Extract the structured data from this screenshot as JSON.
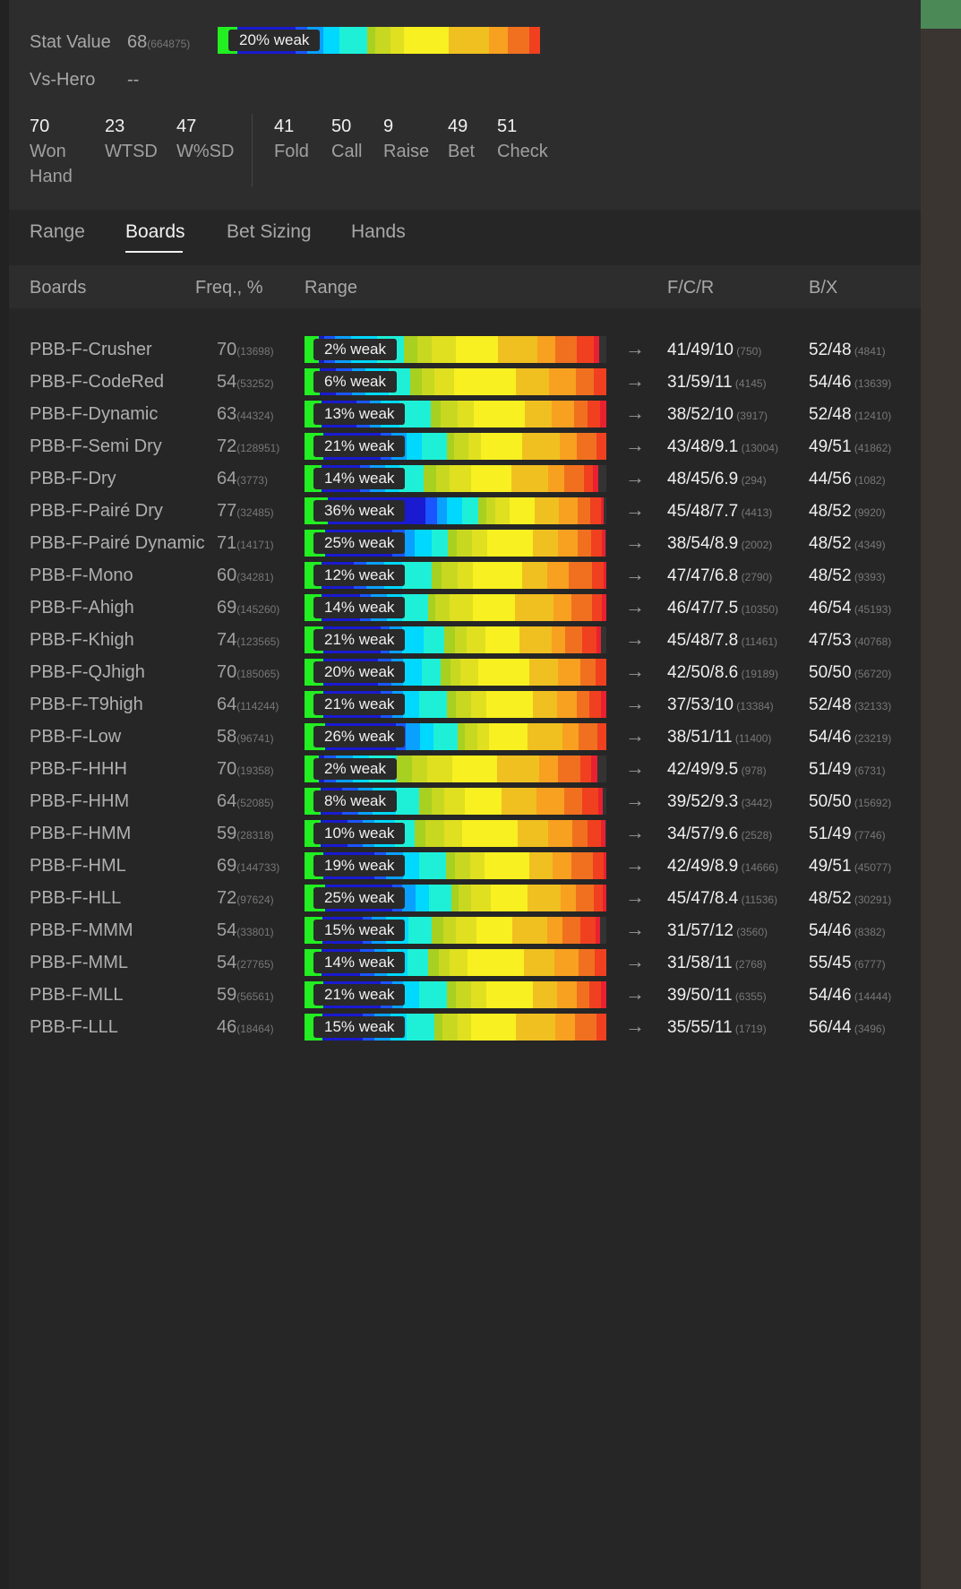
{
  "stat_value": {
    "label": "Stat Value",
    "value": "68",
    "count": "(664875)",
    "weak_label": "20% weak",
    "weak_pct": 20
  },
  "vs_hero": {
    "label": "Vs-Hero",
    "value": "--"
  },
  "counters_left": [
    {
      "value": "70",
      "label": "Won Hand"
    },
    {
      "value": "23",
      "label": "WTSD"
    },
    {
      "value": "47",
      "label": "W%SD"
    }
  ],
  "counters_right": [
    {
      "value": "41",
      "label": "Fold"
    },
    {
      "value": "50",
      "label": "Call"
    },
    {
      "value": "9",
      "label": "Raise"
    },
    {
      "value": "49",
      "label": "Bet"
    },
    {
      "value": "51",
      "label": "Check"
    }
  ],
  "tabs": [
    {
      "label": "Range",
      "active": false
    },
    {
      "label": "Boards",
      "active": true
    },
    {
      "label": "Bet Sizing",
      "active": false
    },
    {
      "label": "Hands",
      "active": false
    }
  ],
  "table_header": {
    "boards": "Boards",
    "freq": "Freq., %",
    "range": "Range",
    "fcr": "F/C/R",
    "bx": "B/X"
  },
  "arrow": "→",
  "colors": {
    "accent_green": "#22ee22",
    "weak_blue": "#1a1ad0",
    "bg": "#262626"
  },
  "rows": [
    {
      "name": "PBB-F-Crusher",
      "freq": "70",
      "freq_count": "(13698)",
      "weak": "2% weak",
      "weak_pct": 2,
      "fcr": "41/49/10",
      "fcr_count": "(750)",
      "bx": "52/48",
      "bx_count": "(4841)"
    },
    {
      "name": "PBB-F-CodeRed",
      "freq": "54",
      "freq_count": "(53252)",
      "weak": "6% weak",
      "weak_pct": 6,
      "fcr": "31/59/11",
      "fcr_count": "(4145)",
      "bx": "54/46",
      "bx_count": "(13639)"
    },
    {
      "name": "PBB-F-Dynamic",
      "freq": "63",
      "freq_count": "(44324)",
      "weak": "13% weak",
      "weak_pct": 13,
      "fcr": "38/52/10",
      "fcr_count": "(3917)",
      "bx": "52/48",
      "bx_count": "(12410)"
    },
    {
      "name": "PBB-F-Semi Dry",
      "freq": "72",
      "freq_count": "(128951)",
      "weak": "21% weak",
      "weak_pct": 21,
      "fcr": "43/48/9.1",
      "fcr_count": "(13004)",
      "bx": "49/51",
      "bx_count": "(41862)"
    },
    {
      "name": "PBB-F-Dry",
      "freq": "64",
      "freq_count": "(3773)",
      "weak": "14% weak",
      "weak_pct": 14,
      "fcr": "48/45/6.9",
      "fcr_count": "(294)",
      "bx": "44/56",
      "bx_count": "(1082)"
    },
    {
      "name": "PBB-F-Pairé Dry",
      "freq": "77",
      "freq_count": "(32485)",
      "weak": "36% weak",
      "weak_pct": 36,
      "fcr": "45/48/7.7",
      "fcr_count": "(4413)",
      "bx": "48/52",
      "bx_count": "(9920)"
    },
    {
      "name": "PBB-F-Pairé Dynamic",
      "freq": "71",
      "freq_count": "(14171)",
      "weak": "25% weak",
      "weak_pct": 25,
      "fcr": "38/54/8.9",
      "fcr_count": "(2002)",
      "bx": "48/52",
      "bx_count": "(4349)"
    },
    {
      "name": "PBB-F-Mono",
      "freq": "60",
      "freq_count": "(34281)",
      "weak": "12% weak",
      "weak_pct": 12,
      "fcr": "47/47/6.8",
      "fcr_count": "(2790)",
      "bx": "48/52",
      "bx_count": "(9393)"
    },
    {
      "name": "PBB-F-Ahigh",
      "freq": "69",
      "freq_count": "(145260)",
      "weak": "14% weak",
      "weak_pct": 14,
      "fcr": "46/47/7.5",
      "fcr_count": "(10350)",
      "bx": "46/54",
      "bx_count": "(45193)"
    },
    {
      "name": "PBB-F-Khigh",
      "freq": "74",
      "freq_count": "(123565)",
      "weak": "21% weak",
      "weak_pct": 21,
      "fcr": "45/48/7.8",
      "fcr_count": "(11461)",
      "bx": "47/53",
      "bx_count": "(40768)"
    },
    {
      "name": "PBB-F-QJhigh",
      "freq": "70",
      "freq_count": "(185065)",
      "weak": "20% weak",
      "weak_pct": 20,
      "fcr": "42/50/8.6",
      "fcr_count": "(19189)",
      "bx": "50/50",
      "bx_count": "(56720)"
    },
    {
      "name": "PBB-F-T9high",
      "freq": "64",
      "freq_count": "(114244)",
      "weak": "21% weak",
      "weak_pct": 21,
      "fcr": "37/53/10",
      "fcr_count": "(13384)",
      "bx": "52/48",
      "bx_count": "(32133)"
    },
    {
      "name": "PBB-F-Low",
      "freq": "58",
      "freq_count": "(96741)",
      "weak": "26% weak",
      "weak_pct": 26,
      "fcr": "38/51/11",
      "fcr_count": "(11400)",
      "bx": "54/46",
      "bx_count": "(23219)"
    },
    {
      "name": "PBB-F-HHH",
      "freq": "70",
      "freq_count": "(19358)",
      "weak": "2% weak",
      "weak_pct": 2,
      "fcr": "42/49/9.5",
      "fcr_count": "(978)",
      "bx": "51/49",
      "bx_count": "(6731)"
    },
    {
      "name": "PBB-F-HHM",
      "freq": "64",
      "freq_count": "(52085)",
      "weak": "8% weak",
      "weak_pct": 8,
      "fcr": "39/52/9.3",
      "fcr_count": "(3442)",
      "bx": "50/50",
      "bx_count": "(15692)"
    },
    {
      "name": "PBB-F-HMM",
      "freq": "59",
      "freq_count": "(28318)",
      "weak": "10% weak",
      "weak_pct": 10,
      "fcr": "34/57/9.6",
      "fcr_count": "(2528)",
      "bx": "51/49",
      "bx_count": "(7746)"
    },
    {
      "name": "PBB-F-HML",
      "freq": "69",
      "freq_count": "(144733)",
      "weak": "19% weak",
      "weak_pct": 19,
      "fcr": "42/49/8.9",
      "fcr_count": "(14666)",
      "bx": "49/51",
      "bx_count": "(45077)"
    },
    {
      "name": "PBB-F-HLL",
      "freq": "72",
      "freq_count": "(97624)",
      "weak": "25% weak",
      "weak_pct": 25,
      "fcr": "45/47/8.4",
      "fcr_count": "(11536)",
      "bx": "48/52",
      "bx_count": "(30291)"
    },
    {
      "name": "PBB-F-MMM",
      "freq": "54",
      "freq_count": "(33801)",
      "weak": "15% weak",
      "weak_pct": 15,
      "fcr": "31/57/12",
      "fcr_count": "(3560)",
      "bx": "54/46",
      "bx_count": "(8382)"
    },
    {
      "name": "PBB-F-MML",
      "freq": "54",
      "freq_count": "(27765)",
      "weak": "14% weak",
      "weak_pct": 14,
      "fcr": "31/58/11",
      "fcr_count": "(2768)",
      "bx": "55/45",
      "bx_count": "(6777)"
    },
    {
      "name": "PBB-F-MLL",
      "freq": "59",
      "freq_count": "(56561)",
      "weak": "21% weak",
      "weak_pct": 21,
      "fcr": "39/50/11",
      "fcr_count": "(6355)",
      "bx": "54/46",
      "bx_count": "(14444)"
    },
    {
      "name": "PBB-F-LLL",
      "freq": "46",
      "freq_count": "(18464)",
      "weak": "15% weak",
      "weak_pct": 15,
      "fcr": "35/55/11",
      "fcr_count": "(1719)",
      "bx": "56/44",
      "bx_count": "(3496)"
    }
  ]
}
